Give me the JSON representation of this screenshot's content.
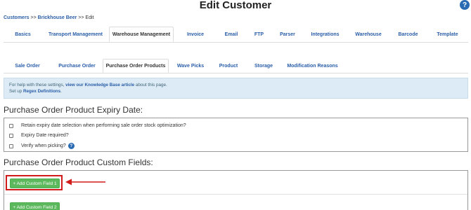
{
  "header": {
    "title": "Edit Customer",
    "help": "?"
  },
  "breadcrumb": {
    "customers": "Customers",
    "sep1": ">>",
    "brand": "Brickhouse Beer",
    "sep2": ">>",
    "current": "Edit"
  },
  "top_tabs": [
    {
      "label": "Basics"
    },
    {
      "label": "Transport Management"
    },
    {
      "label": "Warehouse Management"
    },
    {
      "label": "Invoice"
    },
    {
      "label": "Email"
    },
    {
      "label": "FTP"
    },
    {
      "label": "Parser"
    },
    {
      "label": "Integrations"
    },
    {
      "label": "Warehouse"
    },
    {
      "label": "Barcode"
    },
    {
      "label": "Template"
    }
  ],
  "sub_tabs": [
    {
      "label": "Sale Order"
    },
    {
      "label": "Purchase Order"
    },
    {
      "label": "Purchase Order Products"
    },
    {
      "label": "Wave Picks"
    },
    {
      "label": "Product"
    },
    {
      "label": "Storage"
    },
    {
      "label": "Modification Reasons"
    }
  ],
  "info": {
    "line1_prefix": "For help with these settings,",
    "line1_link": "view our Knowledge Base article",
    "line1_suffix": "about this page.",
    "line2_prefix": "Set up",
    "line2_link": "Regex Definitions",
    "line2_suffix": "."
  },
  "expiry_section": {
    "title": "Purchase Order Product Expiry Date:",
    "options": [
      {
        "label": "Retain expiry date selection when performing sale order stock optimization?"
      },
      {
        "label": "Expiry Date required?"
      },
      {
        "label": "Verify when picking?"
      }
    ]
  },
  "custom_fields_section": {
    "title": "Purchase Order Product Custom Fields:",
    "buttons": [
      {
        "label": "+ Add Custom Field 1"
      },
      {
        "label": "+ Add Custom Field 2"
      }
    ]
  },
  "colors": {
    "accent": "#2a5ea8",
    "button_green": "#5cb85c",
    "highlight_red": "#d11a1a",
    "info_bg": "#dcebf5"
  }
}
